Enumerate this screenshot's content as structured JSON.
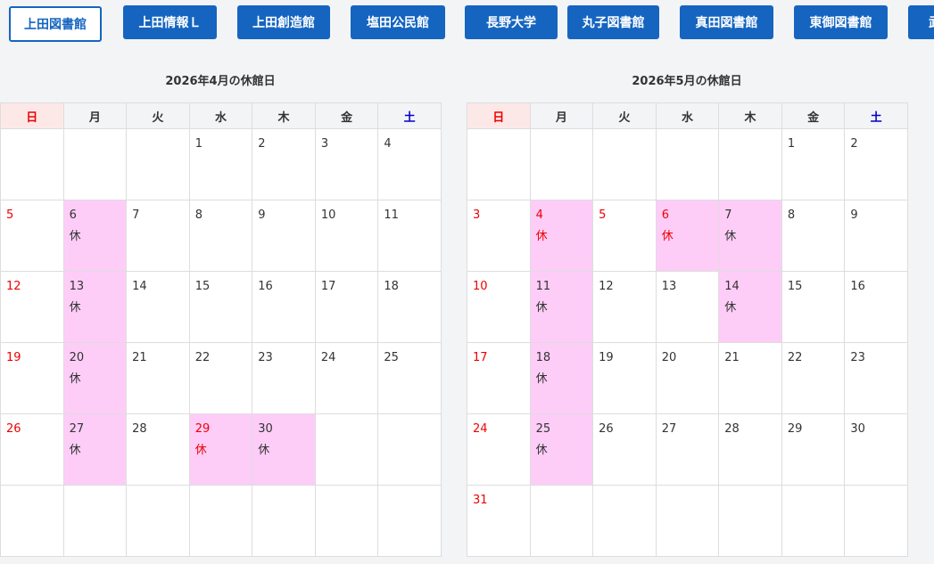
{
  "tabs": [
    {
      "label": "上田図書館",
      "active": true
    },
    {
      "label": "上田情報Ｌ",
      "active": false
    },
    {
      "label": "上田創造館",
      "active": false
    },
    {
      "label": "塩田公民館",
      "active": false
    },
    {
      "label": "長野大学",
      "active": false
    },
    {
      "label": "丸子図書館",
      "active": false
    },
    {
      "label": "真田図書館",
      "active": false
    },
    {
      "label": "東御図書館",
      "active": false
    },
    {
      "label": "武",
      "active": false
    }
  ],
  "weekdays": [
    "日",
    "月",
    "火",
    "水",
    "木",
    "金",
    "土"
  ],
  "closed_mark": "休",
  "calendars": [
    {
      "title": "2026年4月の休館日",
      "weeks": [
        [
          {
            "day": ""
          },
          {
            "day": ""
          },
          {
            "day": ""
          },
          {
            "day": "1"
          },
          {
            "day": "2"
          },
          {
            "day": "3"
          },
          {
            "day": "4"
          }
        ],
        [
          {
            "day": "5",
            "red": true
          },
          {
            "day": "6",
            "closed": true
          },
          {
            "day": "7"
          },
          {
            "day": "8"
          },
          {
            "day": "9"
          },
          {
            "day": "10"
          },
          {
            "day": "11"
          }
        ],
        [
          {
            "day": "12",
            "red": true
          },
          {
            "day": "13",
            "closed": true
          },
          {
            "day": "14"
          },
          {
            "day": "15"
          },
          {
            "day": "16"
          },
          {
            "day": "17"
          },
          {
            "day": "18"
          }
        ],
        [
          {
            "day": "19",
            "red": true
          },
          {
            "day": "20",
            "closed": true
          },
          {
            "day": "21"
          },
          {
            "day": "22"
          },
          {
            "day": "23"
          },
          {
            "day": "24"
          },
          {
            "day": "25"
          }
        ],
        [
          {
            "day": "26",
            "red": true
          },
          {
            "day": "27",
            "closed": true
          },
          {
            "day": "28"
          },
          {
            "day": "29",
            "closed": true,
            "red": true
          },
          {
            "day": "30",
            "closed": true
          },
          {
            "day": ""
          },
          {
            "day": ""
          }
        ],
        [
          {
            "day": ""
          },
          {
            "day": ""
          },
          {
            "day": ""
          },
          {
            "day": ""
          },
          {
            "day": ""
          },
          {
            "day": ""
          },
          {
            "day": ""
          }
        ]
      ]
    },
    {
      "title": "2026年5月の休館日",
      "weeks": [
        [
          {
            "day": ""
          },
          {
            "day": ""
          },
          {
            "day": ""
          },
          {
            "day": ""
          },
          {
            "day": ""
          },
          {
            "day": "1"
          },
          {
            "day": "2"
          }
        ],
        [
          {
            "day": "3",
            "red": true
          },
          {
            "day": "4",
            "closed": true,
            "red": true
          },
          {
            "day": "5",
            "red": true
          },
          {
            "day": "6",
            "closed": true,
            "red": true
          },
          {
            "day": "7",
            "closed": true
          },
          {
            "day": "8"
          },
          {
            "day": "9"
          }
        ],
        [
          {
            "day": "10",
            "red": true
          },
          {
            "day": "11",
            "closed": true
          },
          {
            "day": "12"
          },
          {
            "day": "13"
          },
          {
            "day": "14",
            "closed": true
          },
          {
            "day": "15"
          },
          {
            "day": "16"
          }
        ],
        [
          {
            "day": "17",
            "red": true
          },
          {
            "day": "18",
            "closed": true
          },
          {
            "day": "19"
          },
          {
            "day": "20"
          },
          {
            "day": "21"
          },
          {
            "day": "22"
          },
          {
            "day": "23"
          }
        ],
        [
          {
            "day": "24",
            "red": true
          },
          {
            "day": "25",
            "closed": true
          },
          {
            "day": "26"
          },
          {
            "day": "27"
          },
          {
            "day": "28"
          },
          {
            "day": "29"
          },
          {
            "day": "30"
          }
        ],
        [
          {
            "day": "31",
            "red": true
          },
          {
            "day": ""
          },
          {
            "day": ""
          },
          {
            "day": ""
          },
          {
            "day": ""
          },
          {
            "day": ""
          },
          {
            "day": ""
          }
        ]
      ]
    }
  ],
  "colors": {
    "tab_bg": "#1565c0",
    "closed_bg": "#fdcdf8",
    "holiday_text": "#e00000",
    "saturday_text": "#0000cc",
    "sunday_header_bg": "#fde8e8"
  }
}
